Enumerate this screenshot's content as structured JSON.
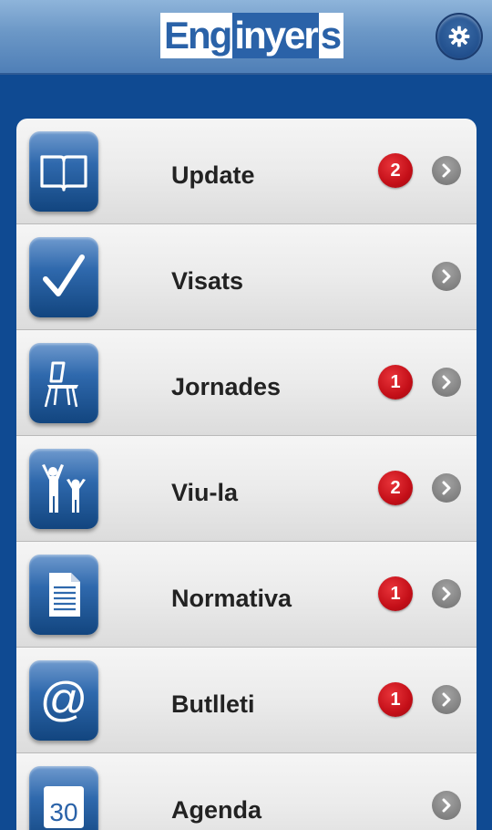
{
  "header": {
    "logo": {
      "part1": "Eng",
      "part2": "inyer",
      "part3": "s"
    },
    "settings_icon": "gear-icon"
  },
  "menu": {
    "items": [
      {
        "label": "Update",
        "badge": "2",
        "icon": "book-icon"
      },
      {
        "label": "Visats",
        "badge": "",
        "icon": "checkmark-icon"
      },
      {
        "label": "Jornades",
        "badge": "1",
        "icon": "chair-icon"
      },
      {
        "label": "Viu-la",
        "badge": "2",
        "icon": "people-icon"
      },
      {
        "label": "Normativa",
        "badge": "1",
        "icon": "document-icon"
      },
      {
        "label": "Butlleti",
        "badge": "1",
        "icon": "at-sign-icon"
      },
      {
        "label": "Agenda",
        "badge": "",
        "icon": "calendar-icon",
        "icon_text": "30"
      }
    ]
  },
  "colors": {
    "brand_blue": "#0f4a92",
    "badge_red": "#c40f18",
    "row_bg": "#ebebeb"
  }
}
